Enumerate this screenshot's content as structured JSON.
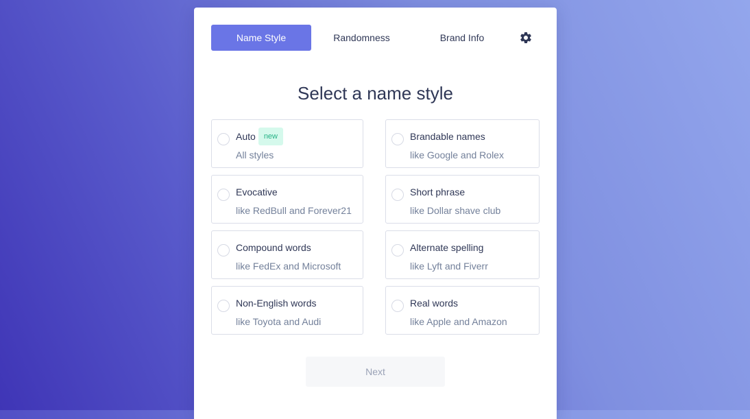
{
  "tabs": [
    {
      "label": "Name Style",
      "active": true
    },
    {
      "label": "Randomness",
      "active": false
    },
    {
      "label": "Brand Info",
      "active": false
    }
  ],
  "settings_icon": "gear-icon",
  "heading": "Select a name style",
  "options": [
    {
      "title": "Auto",
      "badge": "new",
      "subtitle": "All styles"
    },
    {
      "title": "Brandable names",
      "subtitle": "like Google and Rolex"
    },
    {
      "title": "Evocative",
      "subtitle": "like RedBull and Forever21"
    },
    {
      "title": "Short phrase",
      "subtitle": "like Dollar shave club"
    },
    {
      "title": "Compound words",
      "subtitle": "like FedEx and Microsoft"
    },
    {
      "title": "Alternate spelling",
      "subtitle": "like Lyft and Fiverr"
    },
    {
      "title": "Non-English words",
      "subtitle": "like Toyota and Audi"
    },
    {
      "title": "Real words",
      "subtitle": "like Apple and Amazon"
    }
  ],
  "next_label": "Next",
  "colors": {
    "accent": "#6a75e6",
    "badge_bg": "#d5f9ec",
    "badge_text": "#26b286",
    "text_dark": "#2f3756",
    "text_muted": "#73809a"
  }
}
